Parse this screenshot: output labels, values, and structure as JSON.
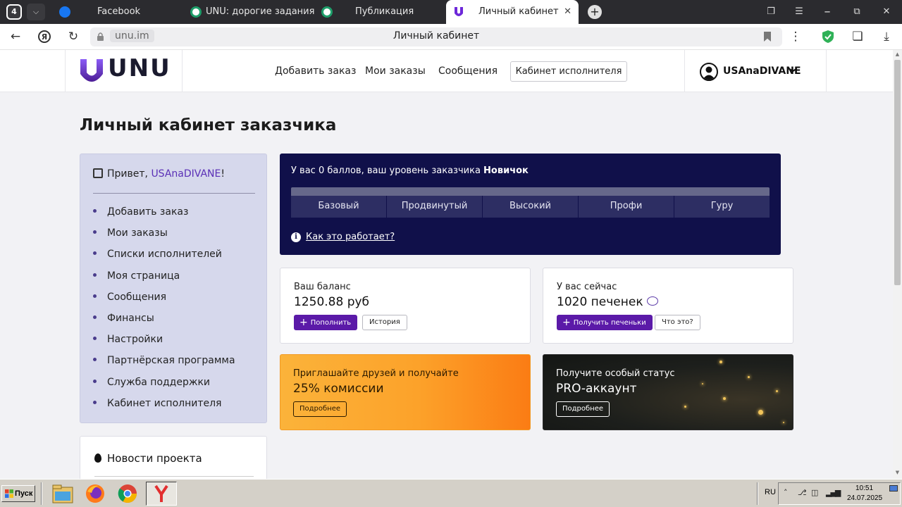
{
  "browser": {
    "tab_count": "4",
    "tabs": [
      {
        "label": "Facebook",
        "icon": "facebook-icon",
        "color": "#1877f2"
      },
      {
        "label": "UNU: дорогие задания дл",
        "icon": "unu-green-icon",
        "color": "#1e9e6a"
      },
      {
        "label": "Публикация",
        "icon": "unu-green-icon",
        "color": "#1e9e6a"
      },
      {
        "label": "Личный кабинет",
        "icon": "unu-logo-icon",
        "color": "#5b21b6",
        "active": true
      }
    ],
    "close_glyph": "✕",
    "new_tab_glyph": "+",
    "url_domain": "unu.im",
    "page_title": "Личный кабинет"
  },
  "header": {
    "logo_text": "UNU",
    "nav": [
      "Добавить заказ",
      "Мои заказы",
      "Сообщения"
    ],
    "cabinet_button": "Кабинет исполнителя",
    "username": "USAnaDIVANE",
    "chevron": "❯"
  },
  "page": {
    "title": "Личный кабинет заказчика"
  },
  "sidebar": {
    "greeting_prefix": "Привет, ",
    "greeting_user": "USAnaDIVANE",
    "greeting_suffix": "!",
    "items": [
      "Добавить заказ",
      "Мои заказы",
      "Списки исполнителей",
      "Моя страница",
      "Сообщения",
      "Финансы",
      "Настройки",
      "Партнёрская программа",
      "Служба поддержки",
      "Кабинет исполнителя"
    ]
  },
  "news": {
    "title": "Новости проекта"
  },
  "level": {
    "text": "У вас 0 баллов, ваш уровень заказчика ",
    "level_name": "Новичок",
    "progress": 0,
    "steps": [
      "Базовый",
      "Продвинутый",
      "Высокий",
      "Профи",
      "Гуру"
    ],
    "info_glyph": "i",
    "how_link": "Как это работает?"
  },
  "balance": {
    "label": "Ваш баланс",
    "value": "1250.88 руб",
    "topup_button": "Пополнить",
    "history_button": "История"
  },
  "cookies": {
    "label": "У вас сейчас",
    "value": "1020 печенек",
    "get_button": "Получить печеньки",
    "what_button": "Что это?"
  },
  "promo_referral": {
    "line1": "Приглашайте друзей и получайте",
    "line2": "25% комиссии",
    "button": "Подробнее"
  },
  "promo_pro": {
    "line1": "Получите особый статус",
    "line2": "PRO-аккаунт",
    "button": "Подробнее"
  },
  "taskbar": {
    "start_label": "Пуск",
    "language": "RU",
    "time": "10:51",
    "date": "24.07.2025"
  },
  "colors": {
    "accent_purple": "#5b1aa8",
    "level_panel": "#10104a",
    "sidebar_bg": "#d6d8ec",
    "promo_orange": "#fca22a"
  }
}
